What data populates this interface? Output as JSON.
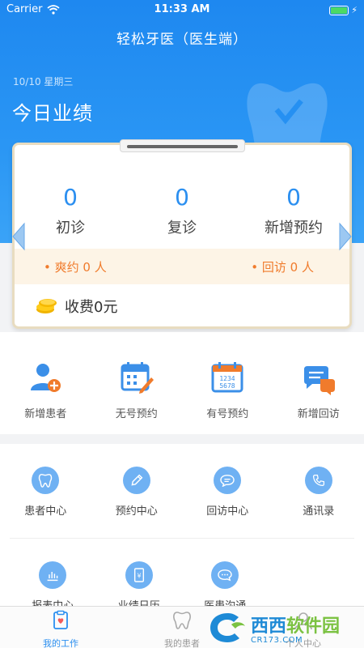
{
  "status_bar": {
    "carrier": "Carrier",
    "time": "11:33 AM"
  },
  "nav": {
    "title": "轻松牙医（医生端）"
  },
  "summary": {
    "date": "10/10 星期三",
    "title": "今日业绩",
    "stats": [
      {
        "value": "0",
        "label": "初诊"
      },
      {
        "value": "0",
        "label": "复诊"
      },
      {
        "value": "0",
        "label": "新增预约"
      }
    ],
    "missed": "• 爽约 0 人",
    "followup": "• 回访 0 人",
    "fee": "收费0元"
  },
  "quick_actions": [
    {
      "label": "新增患者",
      "icon": "add-patient-icon"
    },
    {
      "label": "无号预约",
      "icon": "calendar-edit-icon"
    },
    {
      "label": "有号预约",
      "icon": "calendar-number-icon"
    },
    {
      "label": "新增回访",
      "icon": "chat-bubbles-icon"
    }
  ],
  "modules": [
    {
      "label": "患者中心",
      "icon": "tooth-icon"
    },
    {
      "label": "预约中心",
      "icon": "pencil-icon"
    },
    {
      "label": "回访中心",
      "icon": "chat-icon"
    },
    {
      "label": "通讯录",
      "icon": "phone-icon"
    },
    {
      "label": "报表中心",
      "icon": "bar-chart-icon"
    },
    {
      "label": "业绩日历",
      "icon": "yen-doc-icon"
    },
    {
      "label": "医患沟通",
      "icon": "message-icon"
    }
  ],
  "tabs": [
    {
      "label": "我的工作",
      "icon": "work-icon",
      "active": true
    },
    {
      "label": "我的患者",
      "icon": "tooth-outline-icon",
      "active": false
    },
    {
      "label": "个人中心",
      "icon": "person-icon",
      "active": false
    }
  ],
  "watermark": {
    "main_a": "西西",
    "main_b": "软件园",
    "sub": "CR173.COM"
  },
  "colors": {
    "primary": "#2b8ff0",
    "header": "#1e88f0",
    "accent_orange": "#f07b2c",
    "tan_bg": "#fdf4e6",
    "card_border": "#e8dcc0"
  }
}
